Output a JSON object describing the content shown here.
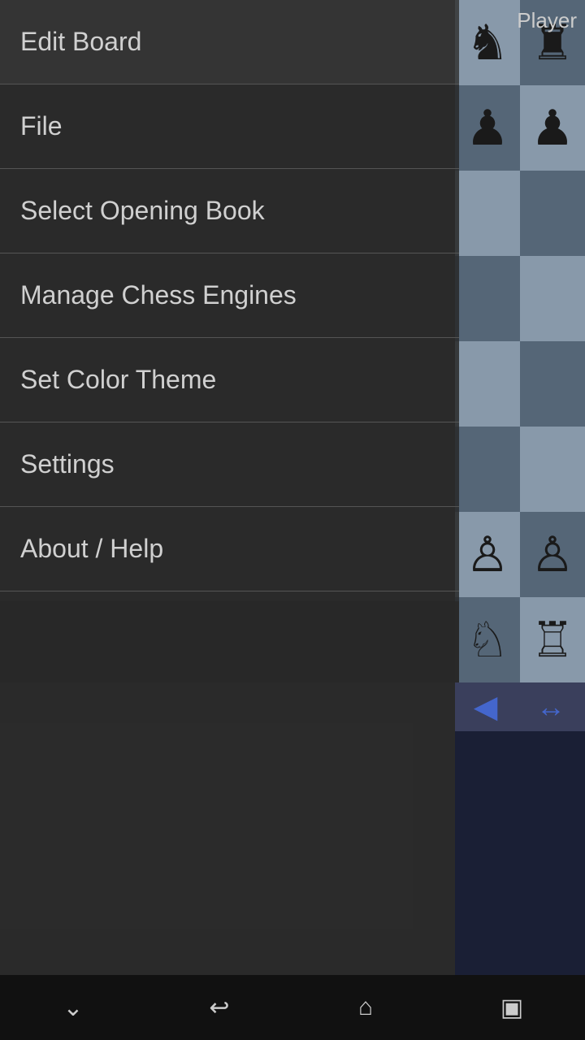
{
  "app": {
    "player_label": "Player"
  },
  "menu": {
    "items": [
      {
        "id": "edit-board",
        "label": "Edit Board"
      },
      {
        "id": "file",
        "label": "File"
      },
      {
        "id": "select-opening-book",
        "label": "Select Opening Book"
      },
      {
        "id": "manage-chess-engines",
        "label": "Manage Chess Engines"
      },
      {
        "id": "set-color-theme",
        "label": "Set Color Theme"
      },
      {
        "id": "settings",
        "label": "Settings"
      },
      {
        "id": "about-help",
        "label": "About / Help"
      }
    ]
  },
  "chess_board": {
    "pieces": [
      {
        "row": 0,
        "col": 0,
        "piece": "♞",
        "bg": "light"
      },
      {
        "row": 0,
        "col": 1,
        "piece": "♜",
        "bg": "dark"
      },
      {
        "row": 1,
        "col": 0,
        "piece": "♟",
        "bg": "dark"
      },
      {
        "row": 1,
        "col": 1,
        "piece": "♟",
        "bg": "light"
      },
      {
        "row": 2,
        "col": 0,
        "piece": "",
        "bg": "light"
      },
      {
        "row": 2,
        "col": 1,
        "piece": "",
        "bg": "dark"
      },
      {
        "row": 3,
        "col": 0,
        "piece": "",
        "bg": "dark"
      },
      {
        "row": 3,
        "col": 1,
        "piece": "",
        "bg": "light"
      },
      {
        "row": 4,
        "col": 0,
        "piece": "",
        "bg": "light"
      },
      {
        "row": 4,
        "col": 1,
        "piece": "",
        "bg": "dark"
      },
      {
        "row": 5,
        "col": 0,
        "piece": "",
        "bg": "dark"
      },
      {
        "row": 5,
        "col": 1,
        "piece": "",
        "bg": "light"
      },
      {
        "row": 6,
        "col": 0,
        "piece": "♙",
        "bg": "light"
      },
      {
        "row": 6,
        "col": 1,
        "piece": "♙",
        "bg": "dark"
      },
      {
        "row": 7,
        "col": 0,
        "piece": "♘",
        "bg": "dark"
      },
      {
        "row": 7,
        "col": 1,
        "piece": "♖",
        "bg": "light"
      }
    ]
  },
  "nav_arrows": {
    "left": "◀",
    "right": "↔"
  },
  "bottom_nav": {
    "dropdown_icon": "⌄",
    "back_icon": "↩",
    "home_icon": "⌂",
    "recents_icon": "▣"
  }
}
